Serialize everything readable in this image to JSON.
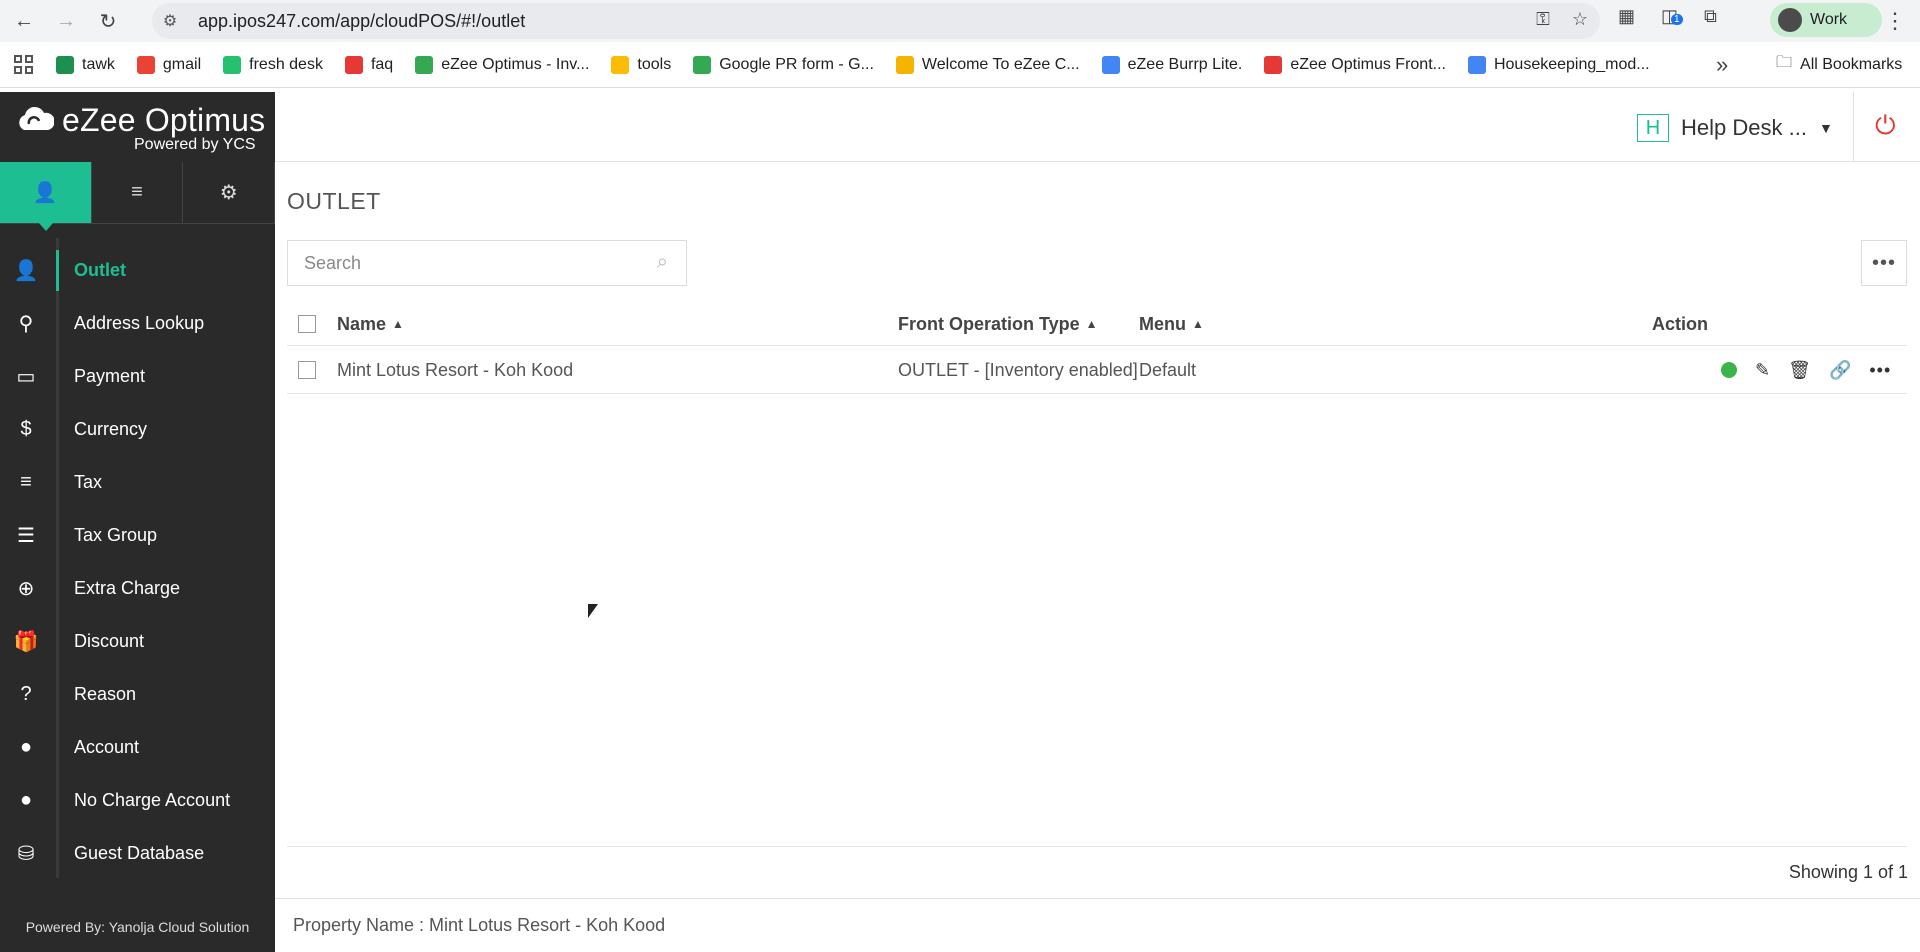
{
  "browser": {
    "url": "app.ipos247.com/app/cloudPOS/#!/outlet",
    "profile_label": "Work",
    "ext_badge": "1",
    "bookmarks": [
      {
        "label": "tawk",
        "color": "#1d8f4e"
      },
      {
        "label": "gmail",
        "color": "#ea4335"
      },
      {
        "label": "fresh desk",
        "color": "#25c16f"
      },
      {
        "label": "faq",
        "color": "#e53935"
      },
      {
        "label": "eZee Optimus - Inv...",
        "color": "#34a853"
      },
      {
        "label": "tools",
        "color": "#fbbc04"
      },
      {
        "label": "Google PR form - G...",
        "color": "#34a853"
      },
      {
        "label": "Welcome To eZee C...",
        "color": "#f5b400"
      },
      {
        "label": "eZee Burrp Lite.",
        "color": "#4285f4"
      },
      {
        "label": "eZee Optimus Front...",
        "color": "#e53935"
      },
      {
        "label": "Housekeeping_mod...",
        "color": "#4285f4"
      }
    ],
    "all_bookmarks": "All Bookmarks"
  },
  "app": {
    "logo_title": "eZee Optimus",
    "logo_sub": "Powered by YCS",
    "hotel_badge": "H",
    "hotel_name": "Help Desk ...",
    "accent": "#1dbf92",
    "powered_by": "Powered By: Yanolja Cloud Solution",
    "property": "Property Name : Mint Lotus Resort - Koh Kood"
  },
  "sidebar": {
    "items": [
      {
        "label": "Outlet",
        "icon": "user-icon",
        "glyph": "👤"
      },
      {
        "label": "Address Lookup",
        "icon": "location-pin-icon",
        "glyph": "⚲"
      },
      {
        "label": "Payment",
        "icon": "credit-card-icon",
        "glyph": "▭"
      },
      {
        "label": "Currency",
        "icon": "dollar-icon",
        "glyph": "$"
      },
      {
        "label": "Tax",
        "icon": "bars-icon",
        "glyph": "≡"
      },
      {
        "label": "Tax Group",
        "icon": "list-icon",
        "glyph": "☰"
      },
      {
        "label": "Extra Charge",
        "icon": "plus-circle-icon",
        "glyph": "⊕"
      },
      {
        "label": "Discount",
        "icon": "gift-icon",
        "glyph": "🎁"
      },
      {
        "label": "Reason",
        "icon": "question-circle-icon",
        "glyph": "?"
      },
      {
        "label": "Account",
        "icon": "person-icon",
        "glyph": "●"
      },
      {
        "label": "No Charge Account",
        "icon": "person-icon",
        "glyph": "●"
      },
      {
        "label": "Guest Database",
        "icon": "database-icon",
        "glyph": "⛁"
      }
    ]
  },
  "page": {
    "title": "OUTLET",
    "search_placeholder": "Search",
    "columns": {
      "name": "Name",
      "front_op": "Front Operation Type",
      "menu": "Menu",
      "action": "Action"
    },
    "rows": [
      {
        "name": "Mint Lotus Resort - Koh Kood",
        "front_op": "OUTLET - [Inventory enabled]",
        "menu": "Default"
      }
    ],
    "showing": "Showing 1 of 1"
  }
}
